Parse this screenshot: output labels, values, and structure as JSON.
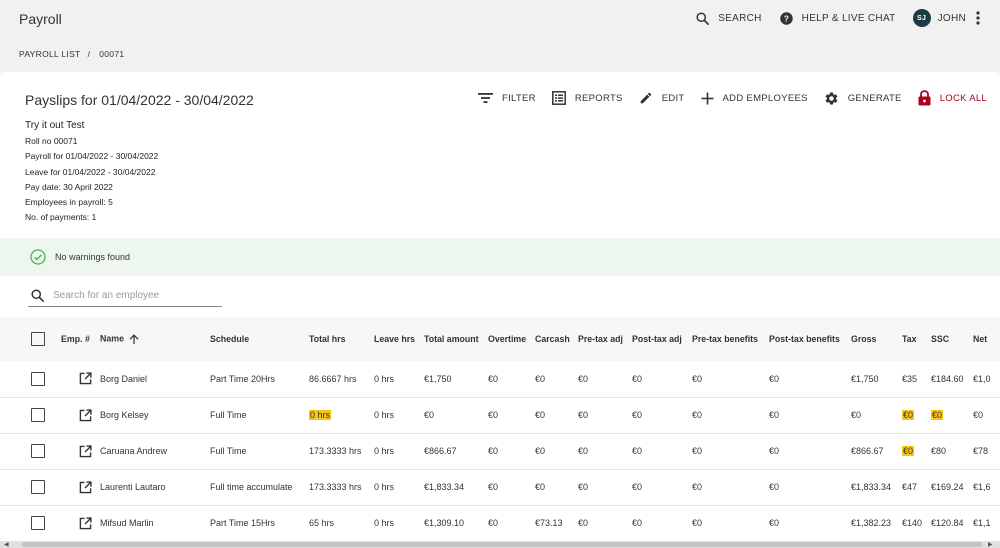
{
  "app": {
    "title": "Payroll"
  },
  "top_actions": {
    "search": "SEARCH",
    "help": "HELP & LIVE CHAT",
    "user_initials": "SJ",
    "user_name": "JOHN"
  },
  "breadcrumb": {
    "root": "PAYROLL LIST",
    "separator": "/",
    "current": "00071"
  },
  "payslips": {
    "title": "Payslips for 01/04/2022 - 30/04/2022",
    "actions": {
      "filter": "FILTER",
      "reports": "REPORTS",
      "edit": "EDIT",
      "add_employees": "ADD EMPLOYEES",
      "generate": "GENERATE",
      "lock_all": "LOCK ALL"
    },
    "info": {
      "try_it_out": "Try it out Test",
      "roll_no": "Roll no 00071",
      "payroll_for": "Payroll for 01/04/2022 - 30/04/2022",
      "leave_for": "Leave for 01/04/2022 - 30/04/2022",
      "pay_date": "Pay date: 30 April 2022",
      "employees": "Employees in payroll: 5",
      "payments": "No. of payments: 1"
    },
    "warnings": "No warnings found",
    "search_placeholder": "Search for an employee"
  },
  "colors": {
    "accent": "#b00020",
    "highlight": "#f5c518",
    "success": "#4caf50",
    "avatar": "#1e3a44"
  },
  "table": {
    "columns": {
      "emp": "Emp. #",
      "name": "Name",
      "schedule": "Schedule",
      "total_hrs": "Total hrs",
      "leave_hrs": "Leave hrs",
      "total_amount": "Total amount",
      "overtime": "Overtime",
      "carcash": "Carcash",
      "pretax_adj": "Pre-tax adj",
      "posttax_adj": "Post-tax adj",
      "pretax_benefits": "Pre-tax benefits",
      "posttax_benefits": "Post-tax benefits",
      "gross": "Gross",
      "tax": "Tax",
      "ssc": "SSC",
      "net": "Net"
    },
    "rows": [
      {
        "emp": "",
        "name": "Borg Daniel",
        "schedule": "Part Time 20Hrs",
        "total_hrs": "86.6667 hrs",
        "leave_hrs": "0 hrs",
        "total_amount": "€1,750",
        "overtime": "€0",
        "carcash": "€0",
        "pretax_adj": "€0",
        "posttax_adj": "€0",
        "pretax_benefits": "€0",
        "posttax_benefits": "€0",
        "gross": "€1,750",
        "tax": "€35",
        "ssc": "€184.60",
        "net": "€1,0"
      },
      {
        "emp": "",
        "name": "Borg Kelsey",
        "schedule": "Full Time",
        "total_hrs": "0 hrs",
        "leave_hrs": "0 hrs",
        "total_amount": "€0",
        "overtime": "€0",
        "carcash": "€0",
        "pretax_adj": "€0",
        "posttax_adj": "€0",
        "pretax_benefits": "€0",
        "posttax_benefits": "€0",
        "gross": "€0",
        "tax": "€0",
        "ssc": "€0",
        "net": "€0"
      },
      {
        "emp": "",
        "name": "Caruana Andrew",
        "schedule": "Full Time",
        "total_hrs": "173.3333 hrs",
        "leave_hrs": "0 hrs",
        "total_amount": "€866.67",
        "overtime": "€0",
        "carcash": "€0",
        "pretax_adj": "€0",
        "posttax_adj": "€0",
        "pretax_benefits": "€0",
        "posttax_benefits": "€0",
        "gross": "€866.67",
        "tax": "€0",
        "ssc": "€80",
        "net": "€78"
      },
      {
        "emp": "",
        "name": "Laurenti Lautaro",
        "schedule": "Full time accumulate",
        "total_hrs": "173.3333 hrs",
        "leave_hrs": "0 hrs",
        "total_amount": "€1,833.34",
        "overtime": "€0",
        "carcash": "€0",
        "pretax_adj": "€0",
        "posttax_adj": "€0",
        "pretax_benefits": "€0",
        "posttax_benefits": "€0",
        "gross": "€1,833.34",
        "tax": "€47",
        "ssc": "€169.24",
        "net": "€1,6"
      },
      {
        "emp": "",
        "name": "Mifsud Marlin",
        "schedule": "Part Time 15Hrs",
        "total_hrs": "65 hrs",
        "leave_hrs": "0 hrs",
        "total_amount": "€1,309.10",
        "overtime": "€0",
        "carcash": "€73.13",
        "pretax_adj": "€0",
        "posttax_adj": "€0",
        "pretax_benefits": "€0",
        "posttax_benefits": "€0",
        "gross": "€1,382.23",
        "tax": "€140",
        "ssc": "€120.84",
        "net": "€1,1"
      }
    ]
  }
}
